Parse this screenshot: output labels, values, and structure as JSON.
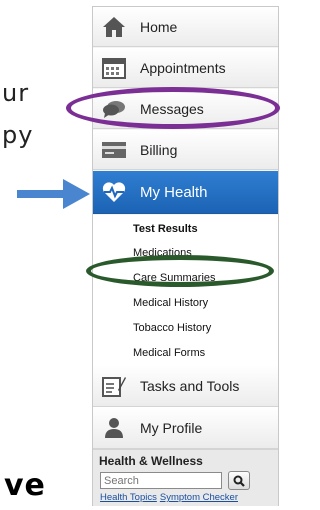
{
  "slide_fragments": [
    "ur",
    "py",
    "ve"
  ],
  "nav": {
    "items": [
      {
        "label": "Home",
        "icon": "home-icon"
      },
      {
        "label": "Appointments",
        "icon": "calendar-icon"
      },
      {
        "label": "Messages",
        "icon": "chat-icon"
      },
      {
        "label": "Billing",
        "icon": "billing-card-icon"
      },
      {
        "label": "My Health",
        "icon": "heartbeat-icon",
        "active": true
      },
      {
        "label": "Tasks and Tools",
        "icon": "tasks-icon"
      },
      {
        "label": "My Profile",
        "icon": "person-icon"
      }
    ],
    "submenu": [
      {
        "label": "Test Results",
        "bold": true
      },
      {
        "label": "Medications"
      },
      {
        "label": "Care Summaries"
      },
      {
        "label": "Medical History"
      },
      {
        "label": "Tobacco History"
      },
      {
        "label": "Medical Forms"
      }
    ]
  },
  "health_wellness": {
    "title": "Health & Wellness",
    "search_placeholder": "Search",
    "links": [
      "Health Topics",
      "Symptom Checker"
    ]
  },
  "colors": {
    "active_blue": "#1f69bd",
    "annotation_purple": "#7b2f95",
    "annotation_green": "#2a5a2c",
    "arrow_blue": "#4a86d0"
  }
}
